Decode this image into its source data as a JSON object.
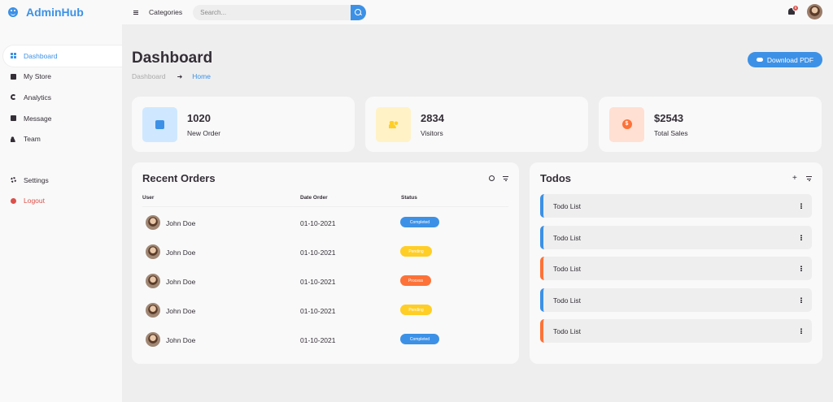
{
  "brand": {
    "name": "AdminHub"
  },
  "sidebar": {
    "items": [
      {
        "label": "Dashboard",
        "icon": "grid-icon",
        "active": true
      },
      {
        "label": "My Store",
        "icon": "store-icon"
      },
      {
        "label": "Analytics",
        "icon": "donut-chart-icon"
      },
      {
        "label": "Message",
        "icon": "message-icon"
      },
      {
        "label": "Team",
        "icon": "team-icon"
      }
    ],
    "bottom_items": [
      {
        "label": "Settings",
        "icon": "gear-icon"
      },
      {
        "label": "Logout",
        "icon": "logout-icon"
      }
    ]
  },
  "topbar": {
    "categories_label": "Categories",
    "search_placeholder": "Search...",
    "notification_count": "8"
  },
  "header": {
    "title": "Dashboard",
    "breadcrumb": [
      "Dashboard",
      "Home"
    ],
    "download_label": "Download PDF"
  },
  "stats": [
    {
      "value": "1020",
      "label": "New Order",
      "icon": "calendar-check-icon"
    },
    {
      "value": "2834",
      "label": "Visitors",
      "icon": "people-icon"
    },
    {
      "value": "$2543",
      "label": "Total Sales",
      "icon": "dollar-icon"
    }
  ],
  "orders": {
    "title": "Recent Orders",
    "columns": [
      "User",
      "Date Order",
      "Status"
    ],
    "rows": [
      {
        "user": "John Doe",
        "date": "01-10-2021",
        "status": "Completed"
      },
      {
        "user": "John Doe",
        "date": "01-10-2021",
        "status": "Pending"
      },
      {
        "user": "John Doe",
        "date": "01-10-2021",
        "status": "Process"
      },
      {
        "user": "John Doe",
        "date": "01-10-2021",
        "status": "Pending"
      },
      {
        "user": "John Doe",
        "date": "01-10-2021",
        "status": "Completed"
      }
    ]
  },
  "todos": {
    "title": "Todos",
    "items": [
      {
        "label": "Todo List",
        "state": "completed"
      },
      {
        "label": "Todo List",
        "state": "completed"
      },
      {
        "label": "Todo List",
        "state": "not-completed"
      },
      {
        "label": "Todo List",
        "state": "completed"
      },
      {
        "label": "Todo List",
        "state": "not-completed"
      }
    ]
  },
  "colors": {
    "accent": "#3C91E6",
    "yellow": "#FFCE26",
    "orange": "#FD7238",
    "red": "#DB504A",
    "dark": "#342E37"
  }
}
